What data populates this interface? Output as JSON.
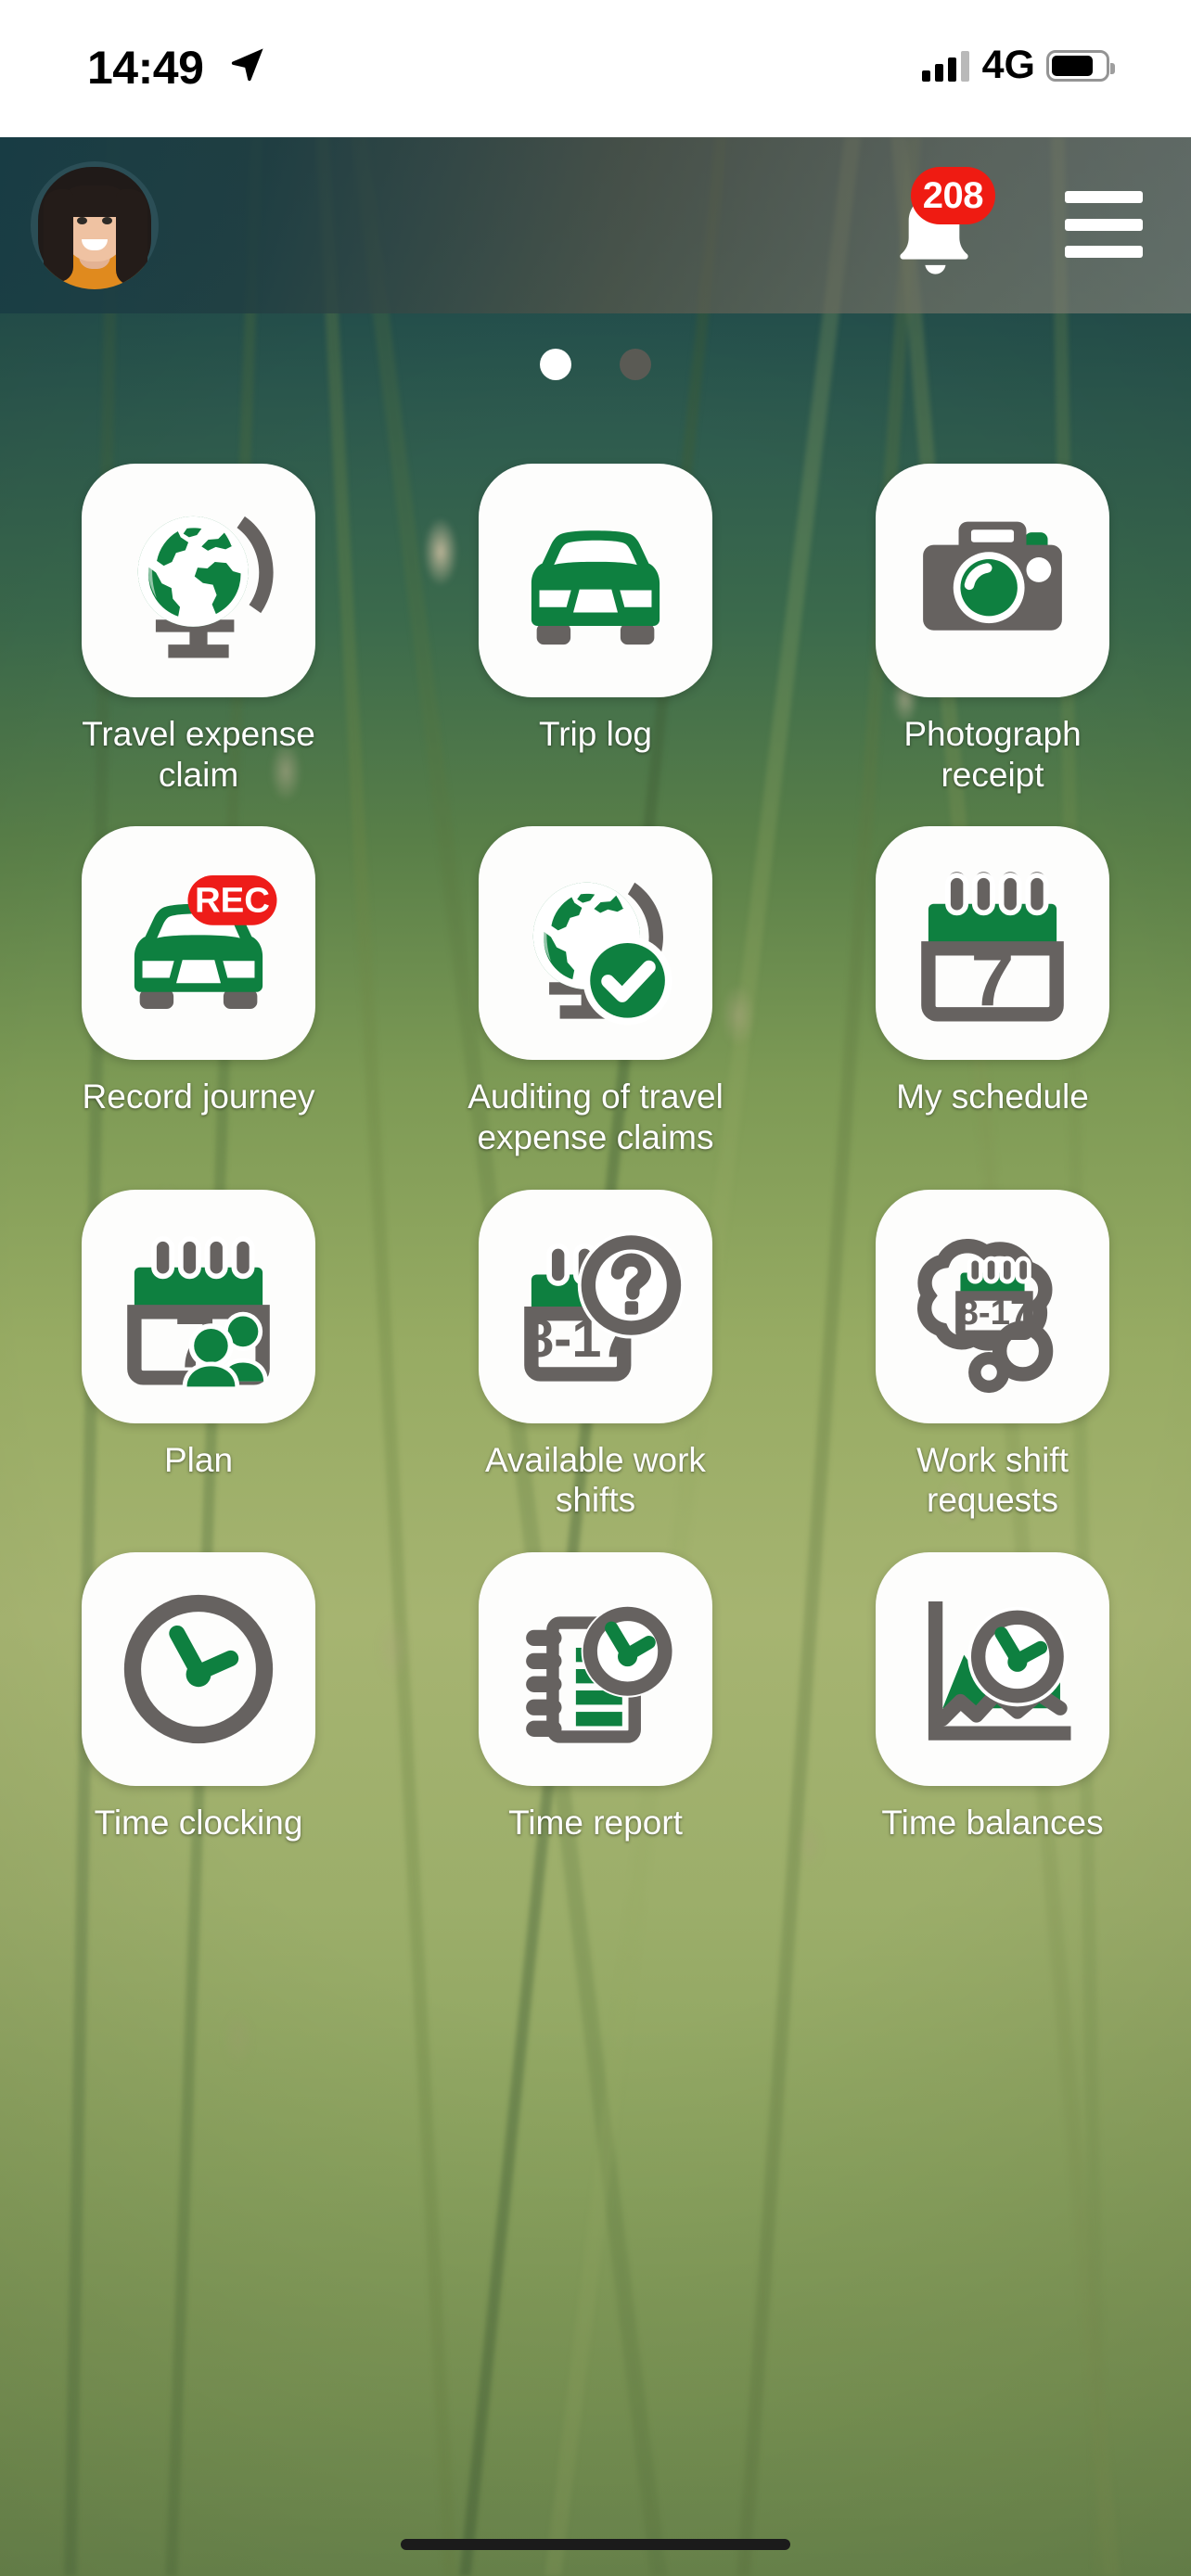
{
  "status_bar": {
    "time": "14:49",
    "location_icon": "location-arrow-icon",
    "network": "4G",
    "signal_icon": "signal-bars-icon",
    "battery_icon": "battery-icon",
    "battery_level": 78
  },
  "header": {
    "avatar": "user-avatar",
    "notification_icon": "bell-icon",
    "notification_count": "208",
    "menu_icon": "hamburger-menu-icon"
  },
  "pager": {
    "pages": 2,
    "active_index": 0
  },
  "colors": {
    "brand_green": "#0e8040",
    "icon_gray": "#666260",
    "badge_red": "#ef1b12",
    "tile_white": "#fdfdfc",
    "label_white": "#ffffff"
  },
  "grid": {
    "items": [
      {
        "label": "Travel expense claim",
        "icon": "globe-icon"
      },
      {
        "label": "Trip log",
        "icon": "car-front-icon"
      },
      {
        "label": "Photograph receipt",
        "icon": "camera-icon"
      },
      {
        "label": "Record journey",
        "icon": "car-record-icon"
      },
      {
        "label": "Auditing of travel expense claims",
        "icon": "globe-check-icon"
      },
      {
        "label": "My schedule",
        "icon": "calendar-7-icon"
      },
      {
        "label": "Plan",
        "icon": "calendar-people-icon"
      },
      {
        "label": "Available work shifts",
        "icon": "calendar-question-icon"
      },
      {
        "label": "Work shift requests",
        "icon": "thought-bubble-calendar-icon"
      },
      {
        "label": "Time clocking",
        "icon": "clock-icon"
      },
      {
        "label": "Time report",
        "icon": "notepad-clock-icon"
      },
      {
        "label": "Time balances",
        "icon": "chart-clock-icon"
      }
    ],
    "shift_label": "8-17",
    "calendar_day": "7",
    "record_label": "REC"
  },
  "home_indicator": "home-indicator"
}
